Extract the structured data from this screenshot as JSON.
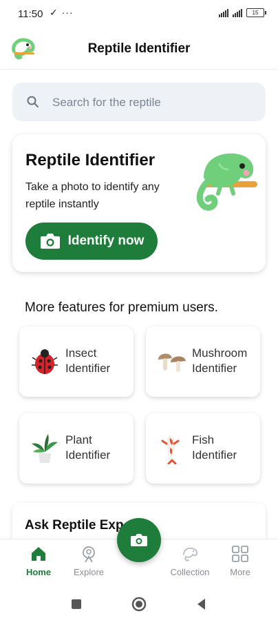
{
  "status_bar": {
    "time": "11:50",
    "left_icons": "✓ ···",
    "battery": "15"
  },
  "header": {
    "title": "Reptile Identifier"
  },
  "search": {
    "placeholder": "Search for the reptile"
  },
  "hero": {
    "title": "Reptile Identifier",
    "subtitle": "Take a photo to identify any reptile instantly",
    "button_label": "Identify now"
  },
  "premium": {
    "heading": "More features for premium users.",
    "features": [
      {
        "label_line1": "Insect",
        "label_line2": "Identifier",
        "icon": "ladybug-icon"
      },
      {
        "label_line1": "Mushroom",
        "label_line2": "Identifier",
        "icon": "mushroom-icon"
      },
      {
        "label_line1": "Plant",
        "label_line2": "Identifier",
        "icon": "potted-plant-icon"
      },
      {
        "label_line1": "Fish",
        "label_line2": "Identifier",
        "icon": "koi-fish-icon"
      }
    ]
  },
  "expert": {
    "title": "Ask Reptile Exp"
  },
  "bottom_nav": {
    "items": [
      {
        "label": "Home",
        "icon": "home-icon",
        "active": true
      },
      {
        "label": "Explore",
        "icon": "explore-icon",
        "active": false
      },
      {
        "label": "Collection",
        "icon": "chameleon-icon",
        "active": false
      },
      {
        "label": "More",
        "icon": "grid-icon",
        "active": false
      }
    ]
  },
  "colors": {
    "accent": "#1e7d3a",
    "search_bg": "#eef1f5",
    "chameleon": "#6fcf7a"
  }
}
